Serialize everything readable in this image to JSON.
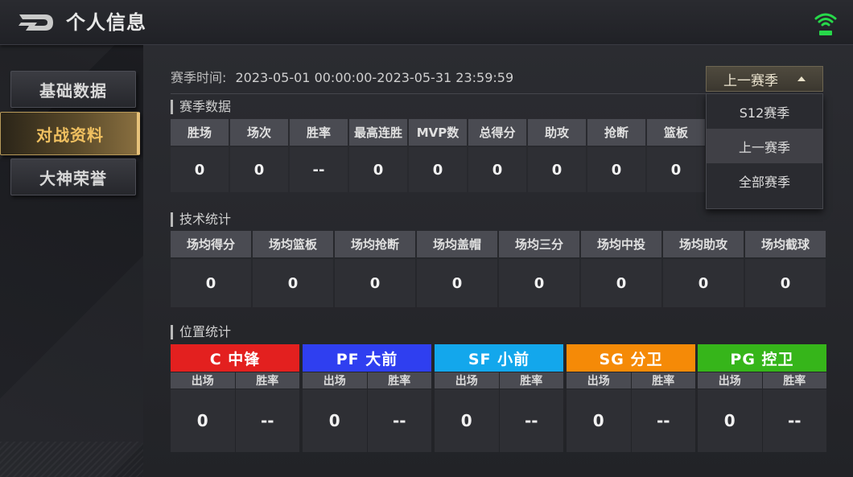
{
  "header": {
    "title": "个人信息"
  },
  "sidebar": {
    "items": [
      {
        "label": "基础数据"
      },
      {
        "label": "对战资料",
        "active": true
      },
      {
        "label": "大神荣誉"
      }
    ]
  },
  "season": {
    "time_label": "赛季时间:",
    "time_value": "2023-05-01 00:00:00-2023-05-31 23:59:59",
    "selected": "上一赛季",
    "options": [
      "S12赛季",
      "上一赛季",
      "全部赛季"
    ]
  },
  "season_stats": {
    "title": "赛季数据",
    "headers": [
      "胜场",
      "场次",
      "胜率",
      "最高连胜",
      "MVP数",
      "总得分",
      "助攻",
      "抢断",
      "篮板"
    ],
    "values": [
      "0",
      "0",
      "--",
      "0",
      "0",
      "0",
      "0",
      "0",
      "0"
    ]
  },
  "tech_stats": {
    "title": "技术统计",
    "headers": [
      "场均得分",
      "场均篮板",
      "场均抢断",
      "场均盖帽",
      "场均三分",
      "场均中投",
      "场均助攻",
      "场均截球"
    ],
    "values": [
      "0",
      "0",
      "0",
      "0",
      "0",
      "0",
      "0",
      "0"
    ]
  },
  "position_stats": {
    "title": "位置统计",
    "sub_headers": [
      "出场",
      "胜率"
    ],
    "positions": [
      {
        "name": "C 中锋",
        "color": "#e3201f",
        "games": "0",
        "win_rate": "--"
      },
      {
        "name": "PF 大前",
        "color": "#2f3ff0",
        "games": "0",
        "win_rate": "--"
      },
      {
        "name": "SF 小前",
        "color": "#13a7ec",
        "games": "0",
        "win_rate": "--"
      },
      {
        "name": "SG 分卫",
        "color": "#f58a07",
        "games": "0",
        "win_rate": "--"
      },
      {
        "name": "PG 控卫",
        "color": "#36b51a",
        "games": "0",
        "win_rate": "--"
      }
    ]
  },
  "colors": {
    "accent": "#f0c060",
    "wifi": "#27d84a"
  }
}
